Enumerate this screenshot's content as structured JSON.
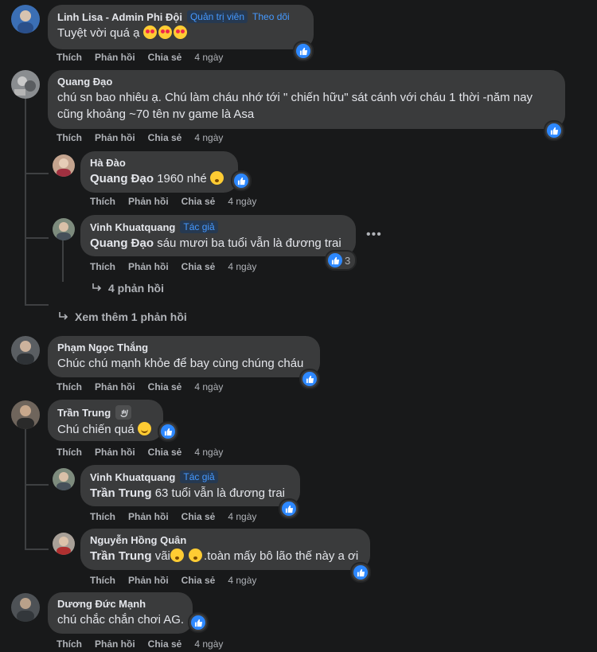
{
  "labels": {
    "like": "Thích",
    "reply": "Phản hồi",
    "share": "Chia sẻ"
  },
  "colors": {
    "background": "#18191a",
    "bubble": "#3a3b3c",
    "accent": "#2d88ff",
    "badge_text": "#4599ff"
  },
  "comments": [
    {
      "name": "Linh Lisa - Admin Phi Đội",
      "badge": "Quản trị viên",
      "follow": "Theo dõi",
      "text": "Tuyệt vời quá ạ",
      "emoji": [
        "heart-eyes-emoji",
        "heart-eyes-emoji",
        "heart-eyes-emoji"
      ],
      "time": "4 ngày"
    },
    {
      "name": "Quang Đạo",
      "text": "chú sn bao nhiêu ạ. Chú làm cháu nhớ tới \" chiến hữu\" sát cánh với cháu 1 thời -năm nay cũng khoảng ~70 tên nv game là Asa",
      "time": "4 ngày",
      "replies": [
        {
          "name": "Hà Đào",
          "mention": "Quang Đạo",
          "text": "1960 nhé",
          "emoji": [
            "flushed-emoji"
          ],
          "time": "4 ngày"
        },
        {
          "name": "Vinh Khuatquang",
          "badge": "Tác giả",
          "mention": "Quang Đạo",
          "text": "sáu mươi ba tuổi vẫn là đương trai",
          "reaction_count": "3",
          "time": "4 ngày"
        }
      ],
      "nested_more": "4 phản hồi",
      "view_more": "Xem thêm 1 phản hồi"
    },
    {
      "name": "Phạm Ngọc Thắng",
      "text": "Chúc chú mạnh khỏe để bay cùng chúng cháu",
      "time": "4 ngày"
    },
    {
      "name": "Trần Trung",
      "fan_badge": "wave-badge-icon",
      "text": "Chú chiến quá",
      "emoji": [
        "smile-emoji"
      ],
      "time": "4 ngày",
      "replies": [
        {
          "name": "Vinh Khuatquang",
          "badge": "Tác giả",
          "mention": "Trần Trung",
          "text": "63 tuổi vẫn là đương trai",
          "time": "4 ngày"
        },
        {
          "name": "Nguyễn Hồng Quân",
          "mention": "Trần Trung",
          "text_a": "vãi",
          "text_b": ".toàn mấy bô lão thế này a ơi",
          "emoji": [
            "flushed-emoji",
            "flushed-emoji"
          ],
          "time": "4 ngày"
        }
      ]
    },
    {
      "name": "Dương Đức Mạnh",
      "text": "chú chắc chắn chơi AG.",
      "time": "4 ngày"
    }
  ]
}
